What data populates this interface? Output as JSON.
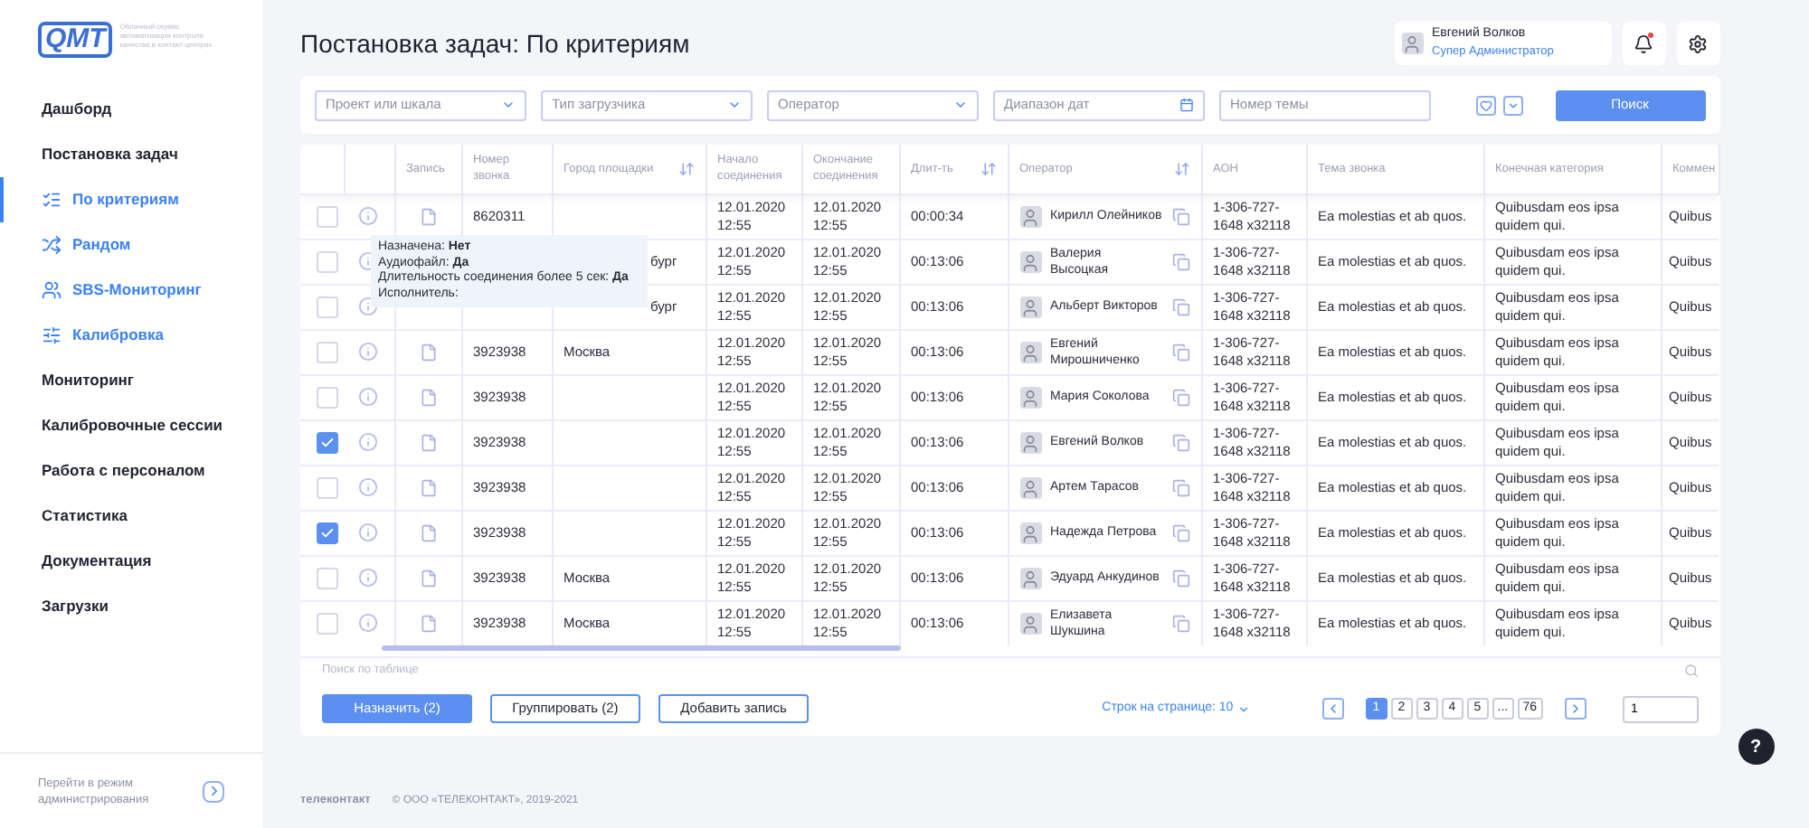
{
  "logo": {
    "mark": "QMT",
    "tagline": "Облачный сервис автоматизации контроля качества в контакт-центрах"
  },
  "sidebar": {
    "items": [
      {
        "label": "Дашборд",
        "kind": "section",
        "selected": false
      },
      {
        "label": "Постановка задач",
        "kind": "section",
        "selected": false
      },
      {
        "label": "По критериям",
        "kind": "sub",
        "selected": true
      },
      {
        "label": "Рандом",
        "kind": "sub",
        "selected": false
      },
      {
        "label": "SBS-Мониторинг",
        "kind": "sub",
        "selected": false
      },
      {
        "label": "Калибровка",
        "kind": "sub",
        "selected": false
      },
      {
        "label": "Мониторинг",
        "kind": "section",
        "selected": false
      },
      {
        "label": "Калибровочные сессии",
        "kind": "section",
        "selected": false
      },
      {
        "label": "Работа с персоналом",
        "kind": "section",
        "selected": false
      },
      {
        "label": "Статистика",
        "kind": "section",
        "selected": false
      },
      {
        "label": "Документация",
        "kind": "section",
        "selected": false
      },
      {
        "label": "Загрузки",
        "kind": "section",
        "selected": false
      }
    ],
    "admin_link": "Перейти в режим администрирования"
  },
  "page_title": "Постановка задач: По критериям",
  "user": {
    "name": "Евгений Волков",
    "role": "Супер Администратор",
    "notifications": true
  },
  "filters": [
    {
      "placeholder": "Проект или шкала",
      "kind": "select"
    },
    {
      "placeholder": "Тип загрузчика",
      "kind": "select"
    },
    {
      "placeholder": "Оператор",
      "kind": "select"
    },
    {
      "placeholder": "Диапазон дат",
      "kind": "date"
    },
    {
      "placeholder": "Номер темы",
      "kind": "text"
    }
  ],
  "search_button": "Поиск",
  "table": {
    "columns": [
      {
        "label": "Запись",
        "sortable": false
      },
      {
        "label": "Номер звонка",
        "sortable": false
      },
      {
        "label": "Город площадки",
        "sortable": true
      },
      {
        "label": "Начало соединения",
        "sortable": false
      },
      {
        "label": "Окончание соединения",
        "sortable": false
      },
      {
        "label": "Длит-ть",
        "sortable": true
      },
      {
        "label": "Оператор",
        "sortable": true
      },
      {
        "label": "АОН",
        "sortable": false
      },
      {
        "label": "Тема звонка",
        "sortable": false
      },
      {
        "label": "Конечная категория",
        "sortable": false
      },
      {
        "label": "Коммен"
      }
    ],
    "rows": [
      {
        "checked": false,
        "record": true,
        "number": "8620311",
        "city": "",
        "start": "12.01.2020 12:55",
        "end": "12.01.2020 12:55",
        "duration": "00:00:34",
        "operator": "Кирилл Олейников",
        "aon": "1-306-727-1648 x32118",
        "topic": "Ea molestias et ab quos.",
        "category": "Quibusdam eos ipsa quidem qui.",
        "comment": "Quibus"
      },
      {
        "checked": false,
        "city": "бург",
        "start": "12.01.2020 12:55",
        "end": "12.01.2020 12:55",
        "duration": "00:13:06",
        "operator": "Валерия Высоцкая",
        "aon": "1-306-727-1648 x32118",
        "topic": "Ea molestias et ab quos.",
        "category": "Quibusdam eos ipsa quidem qui.",
        "comment": "Quibus"
      },
      {
        "checked": false,
        "city": "бург",
        "start": "12.01.2020 12:55",
        "end": "12.01.2020 12:55",
        "duration": "00:13:06",
        "operator": "Альберт Викторов",
        "aon": "1-306-727-1648 x32118",
        "topic": "Ea molestias et ab quos.",
        "category": "Quibusdam eos ipsa quidem qui.",
        "comment": "Quibus"
      },
      {
        "checked": false,
        "record": true,
        "number": "3923938",
        "city": "Москва",
        "start": "12.01.2020 12:55",
        "end": "12.01.2020 12:55",
        "duration": "00:13:06",
        "operator": "Евгений Мирошниченко",
        "aon": "1-306-727-1648 x32118",
        "topic": "Ea molestias et ab quos.",
        "category": "Quibusdam eos ipsa quidem qui.",
        "comment": "Quibus"
      },
      {
        "checked": false,
        "record": true,
        "number": "3923938",
        "city": "",
        "start": "12.01.2020 12:55",
        "end": "12.01.2020 12:55",
        "duration": "00:13:06",
        "operator": "Мария Соколова",
        "aon": "1-306-727-1648 x32118",
        "topic": "Ea molestias et ab quos.",
        "category": "Quibusdam eos ipsa quidem qui.",
        "comment": "Quibus"
      },
      {
        "checked": true,
        "record": true,
        "number": "3923938",
        "city": "",
        "start": "12.01.2020 12:55",
        "end": "12.01.2020 12:55",
        "duration": "00:13:06",
        "operator": "Евгений Волков",
        "aon": "1-306-727-1648 x32118",
        "topic": "Ea molestias et ab quos.",
        "category": "Quibusdam eos ipsa quidem qui.",
        "comment": "Quibus"
      },
      {
        "checked": false,
        "record": true,
        "number": "3923938",
        "city": "",
        "start": "12.01.2020 12:55",
        "end": "12.01.2020 12:55",
        "duration": "00:13:06",
        "operator": "Артем Тарасов",
        "aon": "1-306-727-1648 x32118",
        "topic": "Ea molestias et ab quos.",
        "category": "Quibusdam eos ipsa quidem qui.",
        "comment": "Quibus"
      },
      {
        "checked": true,
        "record": true,
        "number": "3923938",
        "city": "",
        "start": "12.01.2020 12:55",
        "end": "12.01.2020 12:55",
        "duration": "00:13:06",
        "operator": "Надежда Петрова",
        "aon": "1-306-727-1648 x32118",
        "topic": "Ea molestias et ab quos.",
        "category": "Quibusdam eos ipsa quidem qui.",
        "comment": "Quibus"
      },
      {
        "checked": false,
        "record": true,
        "number": "3923938",
        "city": "Москва",
        "start": "12.01.2020 12:55",
        "end": "12.01.2020 12:55",
        "duration": "00:13:06",
        "operator": "Эдуард Анкудинов",
        "aon": "1-306-727-1648 x32118",
        "topic": "Ea molestias et ab quos.",
        "category": "Quibusdam eos ipsa quidem qui.",
        "comment": "Quibus"
      },
      {
        "checked": false,
        "record": true,
        "number": "3923938",
        "city": "Москва",
        "start": "12.01.2020 12:55",
        "end": "12.01.2020 12:55",
        "duration": "00:13:06",
        "operator": "Елизавета Шукшина",
        "aon": "1-306-727-1648 x32118",
        "topic": "Ea molestias et ab quos.",
        "category": "Quibusdam eos ipsa quidem qui.",
        "comment": "Quibus"
      }
    ],
    "search_placeholder": "Поиск по таблице"
  },
  "tooltip": [
    "Назначена: **Нет**",
    "Аудиофайл: **Да**",
    "Длительность соединения более 5 сек: **Да**",
    "Исполнитель:"
  ],
  "actions": [
    {
      "label": "Назначить (2)",
      "kind": "primary"
    },
    {
      "label": "Группировать (2)",
      "kind": "outline"
    },
    {
      "label": "Добавить запись",
      "kind": "outline"
    }
  ],
  "rows_per_page": "Строк на странице: 10",
  "pagination": {
    "pages": [
      {
        "label": "1",
        "selected": true
      },
      {
        "label": "2",
        "selected": false
      },
      {
        "label": "3",
        "selected": false
      },
      {
        "label": "4",
        "selected": false
      },
      {
        "label": "5",
        "selected": false
      },
      {
        "label": "...",
        "selected": false
      },
      {
        "label": "76",
        "selected": false
      }
    ],
    "goto": "1"
  },
  "footer": {
    "brand": "телеконтакт",
    "copyright": "© ООО «ТЕЛЕКОНТАКТ», 2019-2021"
  },
  "help": "?"
}
